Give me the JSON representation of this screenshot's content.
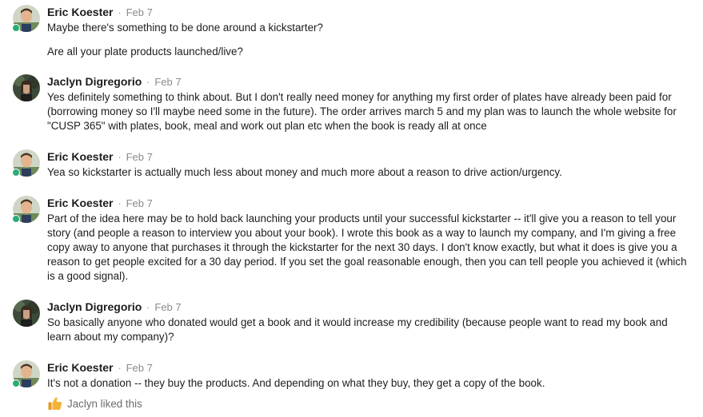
{
  "messages": [
    {
      "author": "Eric Koester",
      "time": "Feb 7",
      "avatar": "eric-avatar",
      "online": true,
      "lines": [
        "Maybe there's something to be done around a kickstarter?",
        "Are all your plate products launched/live?"
      ]
    },
    {
      "author": "Jaclyn Digregorio",
      "time": "Feb 7",
      "avatar": "jaclyn-avatar",
      "online": false,
      "lines": [
        "Yes definitely something to think about. But I don't really need money for anything my first order of plates have already been paid for (borrowing money so I'll maybe need some in the future). The order arrives march 5 and my plan was to launch the whole website for \"CUSP 365\" with plates, book, meal and work out plan etc when the book is ready all at once"
      ]
    },
    {
      "author": "Eric Koester",
      "time": "Feb 7",
      "avatar": "eric-avatar",
      "online": true,
      "lines": [
        "Yea so kickstarter is actually much less about money and much more about a reason to drive action/urgency."
      ]
    },
    {
      "author": "Eric Koester",
      "time": "Feb 7",
      "avatar": "eric-avatar",
      "online": true,
      "lines": [
        "Part of the idea here may be to hold back launching your products until your successful kickstarter -- it'll give you a reason to tell your story (and people a reason to interview you about your book). I wrote this book as a way to launch my company, and I'm giving a free copy away to anyone that purchases it through the kickstarter for the next 30 days. I don't know exactly, but what it does is give you a reason to get people excited for a 30 day period. If you set the goal reasonable enough, then you can tell people you achieved it (which is a good signal)."
      ]
    },
    {
      "author": "Jaclyn Digregorio",
      "time": "Feb 7",
      "avatar": "jaclyn-avatar",
      "online": false,
      "lines": [
        "So basically anyone who donated would get a book and it would increase my credibility (because people want to read my book and learn about my company)?"
      ]
    },
    {
      "author": "Eric Koester",
      "time": "Feb 7",
      "avatar": "eric-avatar",
      "online": true,
      "lines": [
        "It's not a donation -- they buy the products. And depending on what they buy, they get a copy of the book."
      ]
    }
  ],
  "like": {
    "icon": "thumbs-up-icon",
    "text": "Jaclyn liked this"
  },
  "colors": {
    "presence": "#2bac76",
    "like_icon": "#f5b335"
  }
}
